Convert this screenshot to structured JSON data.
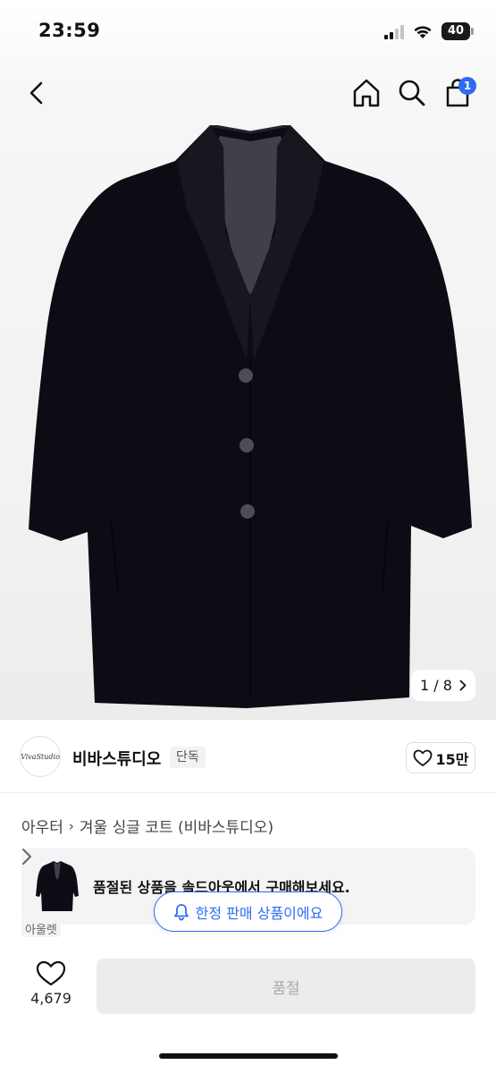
{
  "status_bar": {
    "time": "23:59",
    "battery": "40"
  },
  "nav": {
    "cart_count": "1"
  },
  "gallery": {
    "current": "1",
    "separator": "/",
    "total": "8"
  },
  "brand": {
    "logo_text": "VivaStudio",
    "name": "비바스튜디오",
    "tag": "단독",
    "likes": "15만"
  },
  "breadcrumb": {
    "category": "아우터",
    "product": "겨울 싱글 코트 (비바스튜디오)"
  },
  "soldout_card": {
    "message": "품절된 상품을 솔드아웃에서 구매해보세요.",
    "covered_text": "아울렛"
  },
  "toast": {
    "label": "한정 판매 상품이에요"
  },
  "bottom_bar": {
    "like_count": "4,679",
    "buy_label": "품절"
  },
  "colors": {
    "accent": "#2e6cf6",
    "coat": "#0c0d14",
    "disabled_bg": "#ececec"
  }
}
